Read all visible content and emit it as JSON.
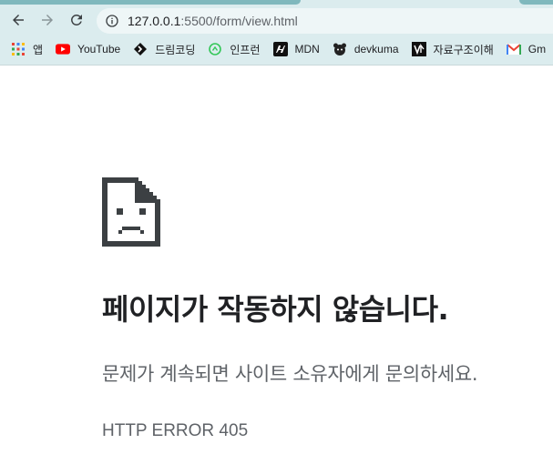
{
  "browser": {
    "url_host": "127.0.0.1",
    "url_path": ":5500/form/view.html",
    "bookmarks": [
      {
        "label": "앱",
        "icon": "apps-grid-icon"
      },
      {
        "label": "YouTube",
        "icon": "youtube-icon"
      },
      {
        "label": "드림코딩",
        "icon": "dreamcoding-icon"
      },
      {
        "label": "인프런",
        "icon": "inflearn-icon"
      },
      {
        "label": "MDN",
        "icon": "mdn-icon"
      },
      {
        "label": "devkuma",
        "icon": "devkuma-icon"
      },
      {
        "label": "자료구조이해",
        "icon": "datastructure-icon"
      },
      {
        "label": "Gm",
        "icon": "gmail-icon"
      }
    ]
  },
  "error_page": {
    "title": "페이지가 작동하지 않습니다.",
    "message": "문제가 계속되면 사이트 소유자에게 문의하세요.",
    "code": "HTTP ERROR 405"
  },
  "colors": {
    "chrome_bg": "#dbecee",
    "omnibox_bg": "#eef6f7",
    "tab_accent": "#7fb8bd",
    "title_text": "#202124",
    "secondary_text": "#5f6368"
  }
}
